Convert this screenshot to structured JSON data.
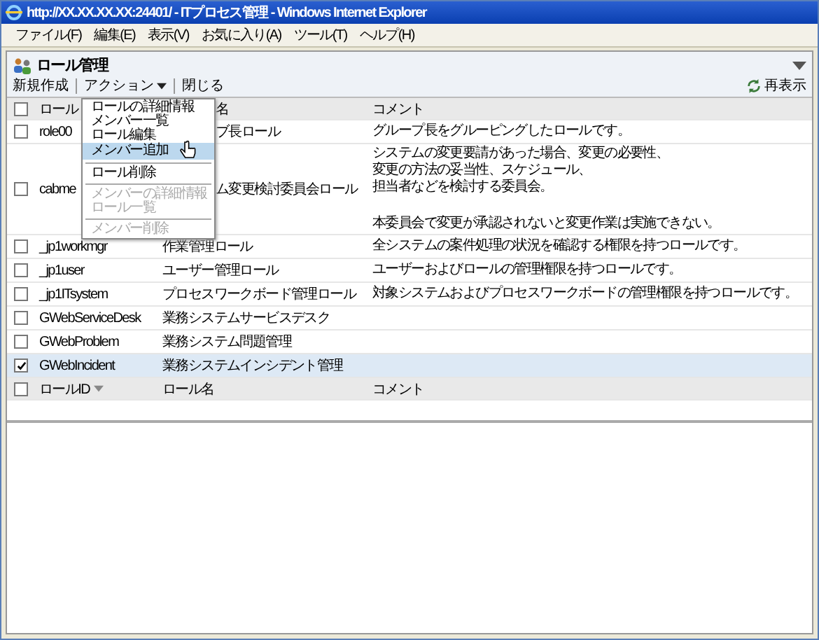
{
  "window": {
    "title": "http://XX.XX.XX.XX:24401/ - ITプロセス管理 - Windows Internet Explorer"
  },
  "menu_bar": [
    "ファイル(F)",
    "編集(E)",
    "表示(V)",
    "お気に入り(A)",
    "ツール(T)",
    "ヘルプ(H)"
  ],
  "page": {
    "title": "ロール管理",
    "refresh": "再表示"
  },
  "toolbar": [
    {
      "label": "新規作成",
      "kind": "plain"
    },
    {
      "label": "アクション",
      "kind": "dropdown"
    },
    {
      "label": "閉じる",
      "kind": "plain"
    }
  ],
  "action_menu": [
    {
      "kind": "item",
      "label": "ロールの詳細情報",
      "disabled": false,
      "selected": false
    },
    {
      "kind": "item",
      "label": "メンバー一覧",
      "disabled": false,
      "selected": false
    },
    {
      "kind": "item",
      "label": "ロール編集",
      "disabled": false,
      "selected": false
    },
    {
      "kind": "item",
      "label": "メンバー追加",
      "disabled": false,
      "selected": true
    },
    {
      "kind": "separator"
    },
    {
      "kind": "item",
      "label": "ロール削除",
      "disabled": false,
      "selected": false
    },
    {
      "kind": "separator"
    },
    {
      "kind": "item",
      "label": "メンバーの詳細情報",
      "disabled": true,
      "selected": false
    },
    {
      "kind": "item",
      "label": "ロール一覧",
      "disabled": true,
      "selected": false
    },
    {
      "kind": "separator"
    },
    {
      "kind": "item",
      "label": "メンバー削除",
      "disabled": true,
      "selected": false
    }
  ],
  "table": {
    "header": {
      "checked": false,
      "columns": [
        "ロール",
        "名",
        "コメント"
      ]
    },
    "rows": [
      {
        "checked": false,
        "id": "role00",
        "name": "ブ長ロール",
        "comment": [
          [
            "グループ長をグルーピングしたロールです。"
          ]
        ]
      },
      {
        "checked": false,
        "id": "cabme",
        "name": "ム変更検討委員会ロール",
        "comment": [
          [
            "システムの変更要請があった場合、変更の必要性、",
            "変更の方法の妥当性、スケジュール、",
            "担当者などを検討する委員会。"
          ],
          [
            "本委員会で変更が承認されないと変更作業は実施できない。"
          ]
        ]
      },
      {
        "checked": false,
        "id": "_jp1workmgr",
        "name": "作業管理ロール",
        "comment": [
          [
            "全システムの案件処理の状況を確認する権限を持つロールです。"
          ]
        ]
      },
      {
        "checked": false,
        "id": "_jp1user",
        "name": "ユーザー管理ロール",
        "comment": [
          [
            "ユーザーおよびロールの管理権限を持つロールです。"
          ]
        ]
      },
      {
        "checked": false,
        "id": "_jp1ITsystem",
        "name": "プロセスワークボード管理ロール",
        "comment": [
          [
            "対象システムおよびプロセスワークボードの管理権限を持つロールです。"
          ]
        ]
      },
      {
        "checked": false,
        "id": "GWebServiceDesk",
        "name": "業務システムサービスデスク",
        "comment": []
      },
      {
        "checked": false,
        "id": "GWebProblem",
        "name": "業務システム問題管理",
        "comment": []
      },
      {
        "checked": true,
        "id": "GWebIncident",
        "name": "業務システムインシデント管理",
        "comment": []
      }
    ],
    "footer": {
      "checked": false,
      "columns": [
        "ロールID",
        "ロール名",
        "コメント"
      ]
    }
  }
}
